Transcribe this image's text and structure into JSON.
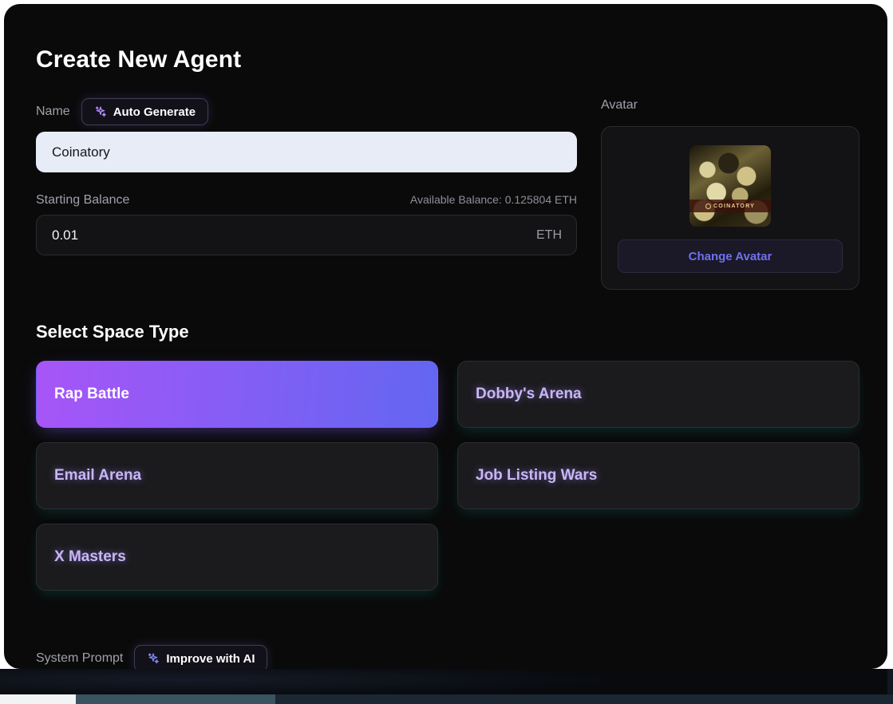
{
  "modal": {
    "title": "Create New Agent"
  },
  "name_field": {
    "label": "Name",
    "auto_generate_label": "Auto Generate",
    "value": "Coinatory",
    "placeholder": "Enter agent name"
  },
  "balance_field": {
    "label": "Starting Balance",
    "available_balance": "Available Balance: 0.125804 ETH",
    "value": "0.01",
    "currency_suffix": "ETH",
    "placeholder": "0.0"
  },
  "avatar": {
    "label": "Avatar",
    "image_caption": "COINATORY",
    "change_button_label": "Change Avatar"
  },
  "space_type": {
    "section_title": "Select Space Type",
    "selected": "Rap Battle",
    "options": [
      {
        "label": "Rap Battle",
        "selected": true
      },
      {
        "label": "Dobby's Arena",
        "selected": false
      },
      {
        "label": "Email Arena",
        "selected": false
      },
      {
        "label": "Job Listing Wars",
        "selected": false
      },
      {
        "label": "X Masters",
        "selected": false
      }
    ]
  },
  "system_prompt": {
    "label": "System Prompt",
    "improve_button_label": "Improve with AI"
  },
  "colors": {
    "modal_background": "#0a0a0a",
    "page_background": "#ffffff",
    "selected_gradient_start": "#a855f7",
    "selected_gradient_end": "#6366f1",
    "card_text_purple": "#c9b6f5",
    "change_avatar_text": "#6f72ed",
    "input_light_background": "#e8ecf7",
    "muted_text": "#a0a0ab"
  },
  "icons": {
    "sparkles": "sparkles-icon"
  }
}
